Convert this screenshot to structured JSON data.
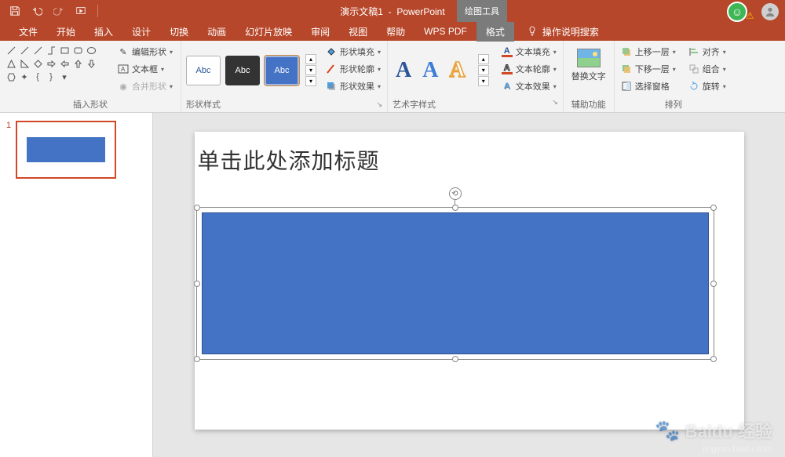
{
  "title": {
    "doc": "演示文稿1",
    "app": "PowerPoint",
    "context_tab": "绘图工具"
  },
  "tabs": {
    "file": "文件",
    "home": "开始",
    "insert": "插入",
    "design": "设计",
    "transitions": "切换",
    "animations": "动画",
    "slideshow": "幻灯片放映",
    "review": "审阅",
    "view": "视图",
    "help": "帮助",
    "wps": "WPS PDF",
    "format": "格式",
    "tellme": "操作说明搜索"
  },
  "ribbon": {
    "insert_shapes": {
      "label": "插入形状",
      "edit_shape": "编辑形状",
      "text_box": "文本框",
      "merge_shapes": "合并形状"
    },
    "shape_styles": {
      "label": "形状样式",
      "swatch_text": "Abc",
      "fill": "形状填充",
      "outline": "形状轮廓",
      "effects": "形状效果"
    },
    "wordart": {
      "label": "艺术字样式",
      "text_fill": "文本填充",
      "text_outline": "文本轮廓",
      "text_effects": "文本效果",
      "glyph": "A"
    },
    "accessibility": {
      "label": "辅助功能",
      "alt_text": "替换文字"
    },
    "arrange": {
      "label": "排列",
      "bring_forward": "上移一层",
      "send_backward": "下移一层",
      "selection_pane": "选择窗格",
      "align": "对齐",
      "group": "组合",
      "rotate": "旋转"
    }
  },
  "slide": {
    "number": "1",
    "title_placeholder": "单击此处添加标题"
  },
  "watermark": {
    "brand": "Baidu",
    "sub": "经验",
    "url": "jingyan.baidu.com"
  }
}
